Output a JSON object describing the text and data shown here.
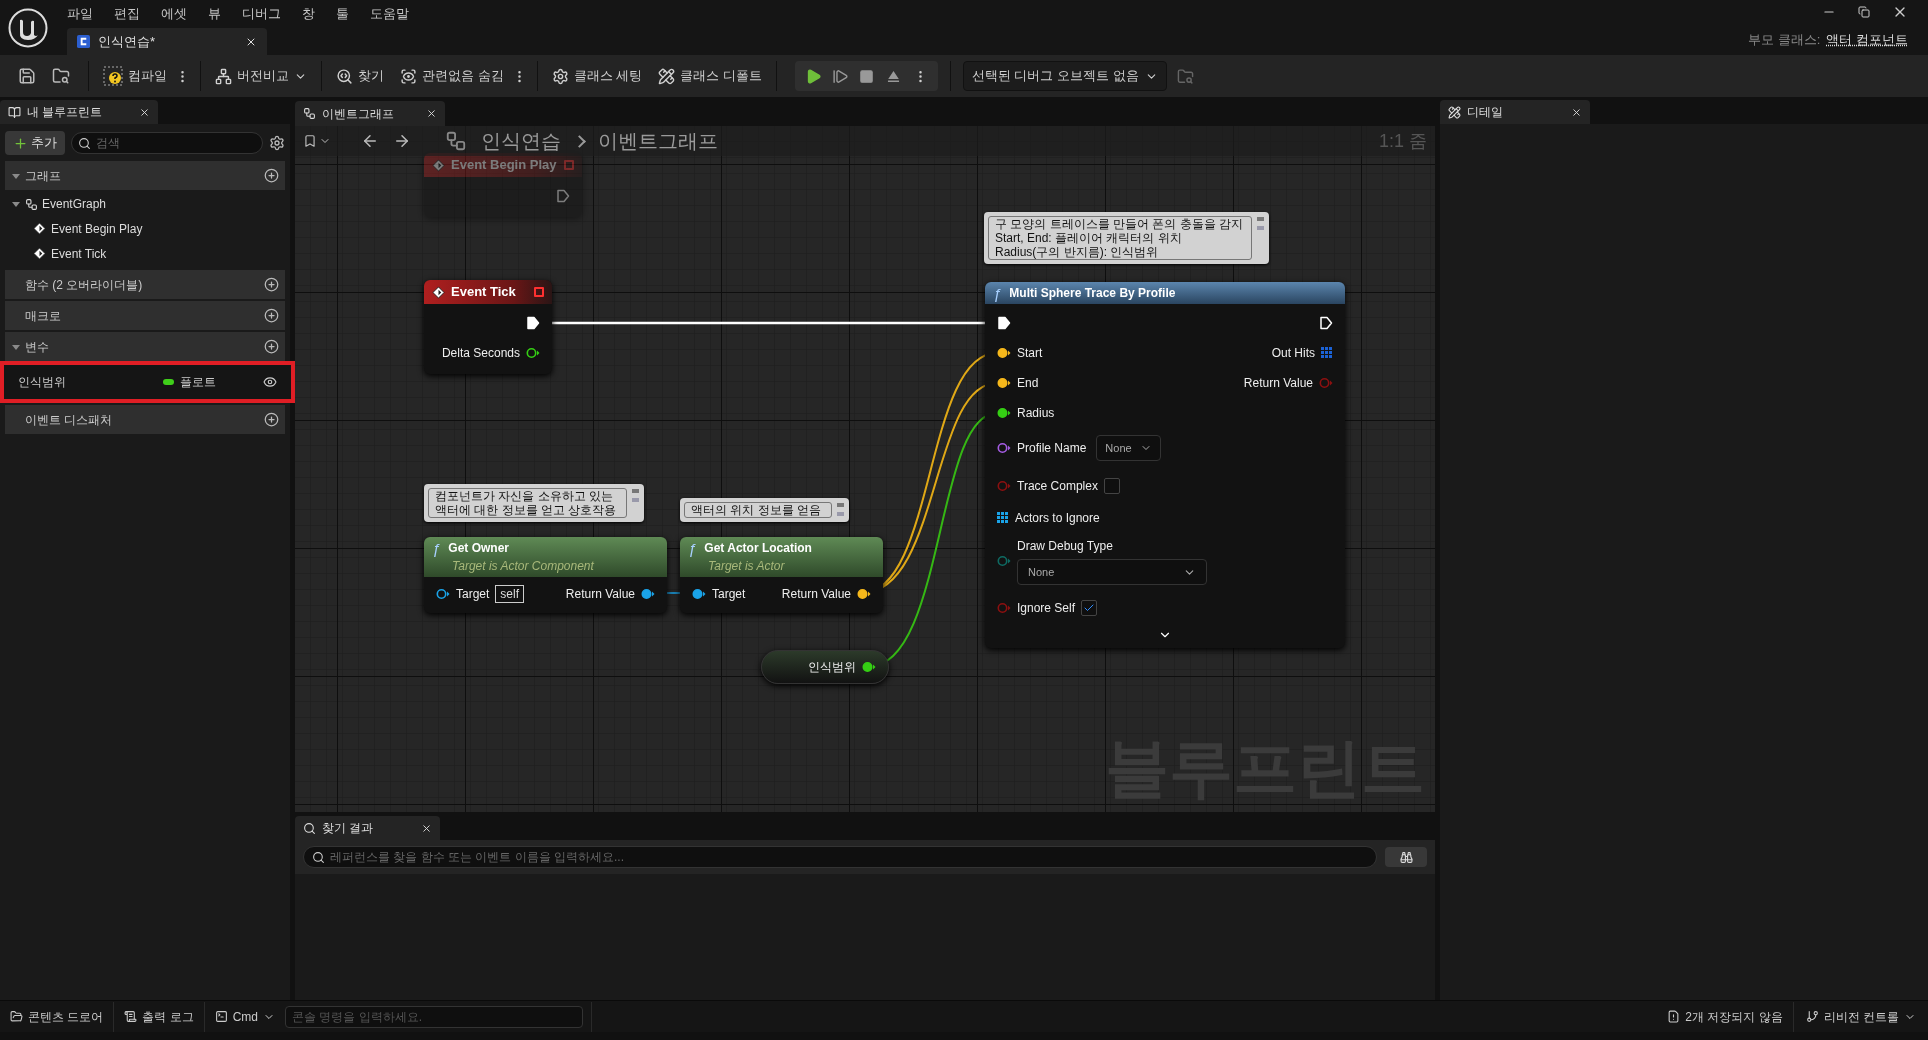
{
  "menu": [
    "파일",
    "편집",
    "에셋",
    "뷰",
    "디버그",
    "창",
    "툴",
    "도움말"
  ],
  "document_tab": {
    "title": "인식연습*"
  },
  "parent_class": {
    "label": "부모 클래스:",
    "value": "액터 컴포넌트"
  },
  "toolbar": {
    "buttons": [
      {
        "label": "컴파일",
        "kind": "menu"
      },
      {
        "label": "버전비교",
        "kind": "dropdown"
      },
      {
        "label": "찾기",
        "kind": "plain"
      },
      {
        "label": "관련없음 숨김",
        "kind": "menu"
      },
      {
        "label": "클래스 세팅",
        "kind": "plain"
      },
      {
        "label": "클래스 디폴트",
        "kind": "plain"
      }
    ],
    "debug_object": "선택된 디버그 오브젝트 없음"
  },
  "my_blueprint": {
    "tab": "내 블루프린트",
    "add_button": "추가",
    "search_placeholder": "검색",
    "sections": [
      {
        "title": "그래프",
        "expanded": true,
        "items": [
          {
            "label": "EventGraph",
            "expanded": true,
            "children": [
              {
                "label": "Event Begin Play"
              },
              {
                "label": "Event Tick"
              }
            ]
          }
        ]
      },
      {
        "title": "함수 (2 오버라이더블)",
        "expanded": false
      },
      {
        "title": "매크로",
        "expanded": false
      },
      {
        "title": "변수",
        "expanded": true,
        "variables": [
          {
            "name": "인식범위",
            "type": "플로트",
            "color": "#3fcf1a",
            "highlighted": true
          }
        ]
      },
      {
        "title": "이벤트 디스패처",
        "expanded": false
      }
    ]
  },
  "graph": {
    "tab": "이벤트그래프",
    "breadcrumb": [
      "인식연습",
      "이벤트그래프"
    ],
    "zoom": "1:1 줌",
    "watermark": "블루프린트",
    "nodes": [
      {
        "kind": "event",
        "title": "Event Begin Play",
        "dimmed": true,
        "exec_out": {
          "connected": false
        }
      },
      {
        "kind": "event",
        "title": "Event Tick",
        "dimmed": false,
        "exec_out": {
          "connected": true
        },
        "outputs": [
          {
            "label": "Delta Seconds",
            "color": "#35cf14",
            "connected": false
          }
        ]
      },
      {
        "kind": "function",
        "glyph": "ƒ",
        "title": "Multi Sphere Trace By Profile",
        "comment": "구 모양의 트레이스를 만들어 폰의 충돌을 감지\nStart, End: 플레이어 캐릭터의 위치\nRadius(구의 반지름): 인식범위",
        "exec_in": {
          "connected": true
        },
        "exec_out": {
          "connected": false
        },
        "rows": [
          {
            "left": {
              "label": "Start",
              "color": "#f6b81b",
              "connected": true
            },
            "right": {
              "label": "Out Hits",
              "color": "#1b62d6",
              "kind": "array"
            }
          },
          {
            "left": {
              "label": "End",
              "color": "#f6b81b",
              "connected": true
            },
            "right": {
              "label": "Return Value",
              "color": "#8c1010",
              "connected": false
            }
          },
          {
            "left": {
              "label": "Radius",
              "color": "#35cf14",
              "connected": true
            }
          },
          {
            "left": {
              "label": "Profile Name",
              "color": "#a55ce3",
              "connected": false
            },
            "value": {
              "kind": "dropdown",
              "text": "None"
            }
          },
          {
            "left": {
              "label": "Trace Complex",
              "color": "#8c1010",
              "connected": false
            },
            "value": {
              "kind": "checkbox",
              "checked": false
            }
          },
          {
            "left": {
              "label": "Actors to Ignore",
              "color": "#1aa3e8",
              "kind": "array"
            }
          },
          {
            "left": {
              "label": "Draw Debug Type",
              "color": "#0e6b63",
              "connected": false
            },
            "value": {
              "kind": "wide_dropdown",
              "text": "None"
            }
          },
          {
            "left": {
              "label": "Ignore Self",
              "color": "#8c1010",
              "connected": false
            },
            "value": {
              "kind": "checkbox",
              "checked": true
            }
          }
        ]
      },
      {
        "kind": "pure_function",
        "glyph": "ƒ",
        "title": "Get Owner",
        "subtitle": "Target is Actor Component",
        "comment": "컴포넌트가 자신을 소유하고 있는\n액터에 대한 정보를 얻고 상호작용",
        "rows": [
          {
            "left": {
              "label": "Target",
              "color": "#1aa3e8",
              "connected": false
            },
            "value": {
              "kind": "text",
              "text": "self"
            },
            "right": {
              "label": "Return Value",
              "color": "#1aa3e8",
              "connected": true
            }
          }
        ]
      },
      {
        "kind": "pure_function",
        "glyph": "ƒ",
        "title": "Get Actor Location",
        "subtitle": "Target is Actor",
        "comment": "액터의 위치 정보를 얻음",
        "rows": [
          {
            "left": {
              "label": "Target",
              "color": "#1aa3e8",
              "connected": true
            },
            "right": {
              "label": "Return Value",
              "color": "#f6b81b",
              "connected": true
            }
          }
        ]
      },
      {
        "kind": "variable",
        "label": "인식범위",
        "pin": {
          "color": "#35cf14",
          "connected": true
        }
      }
    ]
  },
  "find_results": {
    "tab": "찾기 결과",
    "search_placeholder": "레퍼런스를 찾을 함수 또는 이벤트 이름을 입력하세요..."
  },
  "details": {
    "tab": "디테일"
  },
  "status_bar": {
    "buttons": [
      "콘텐츠 드로어",
      "출력 로그"
    ],
    "cmd": "Cmd",
    "console_placeholder": "콘솔 명령을 입력하세요.",
    "unsaved": "2개 저장되지 않음",
    "revision": "리비전 컨트롤"
  }
}
